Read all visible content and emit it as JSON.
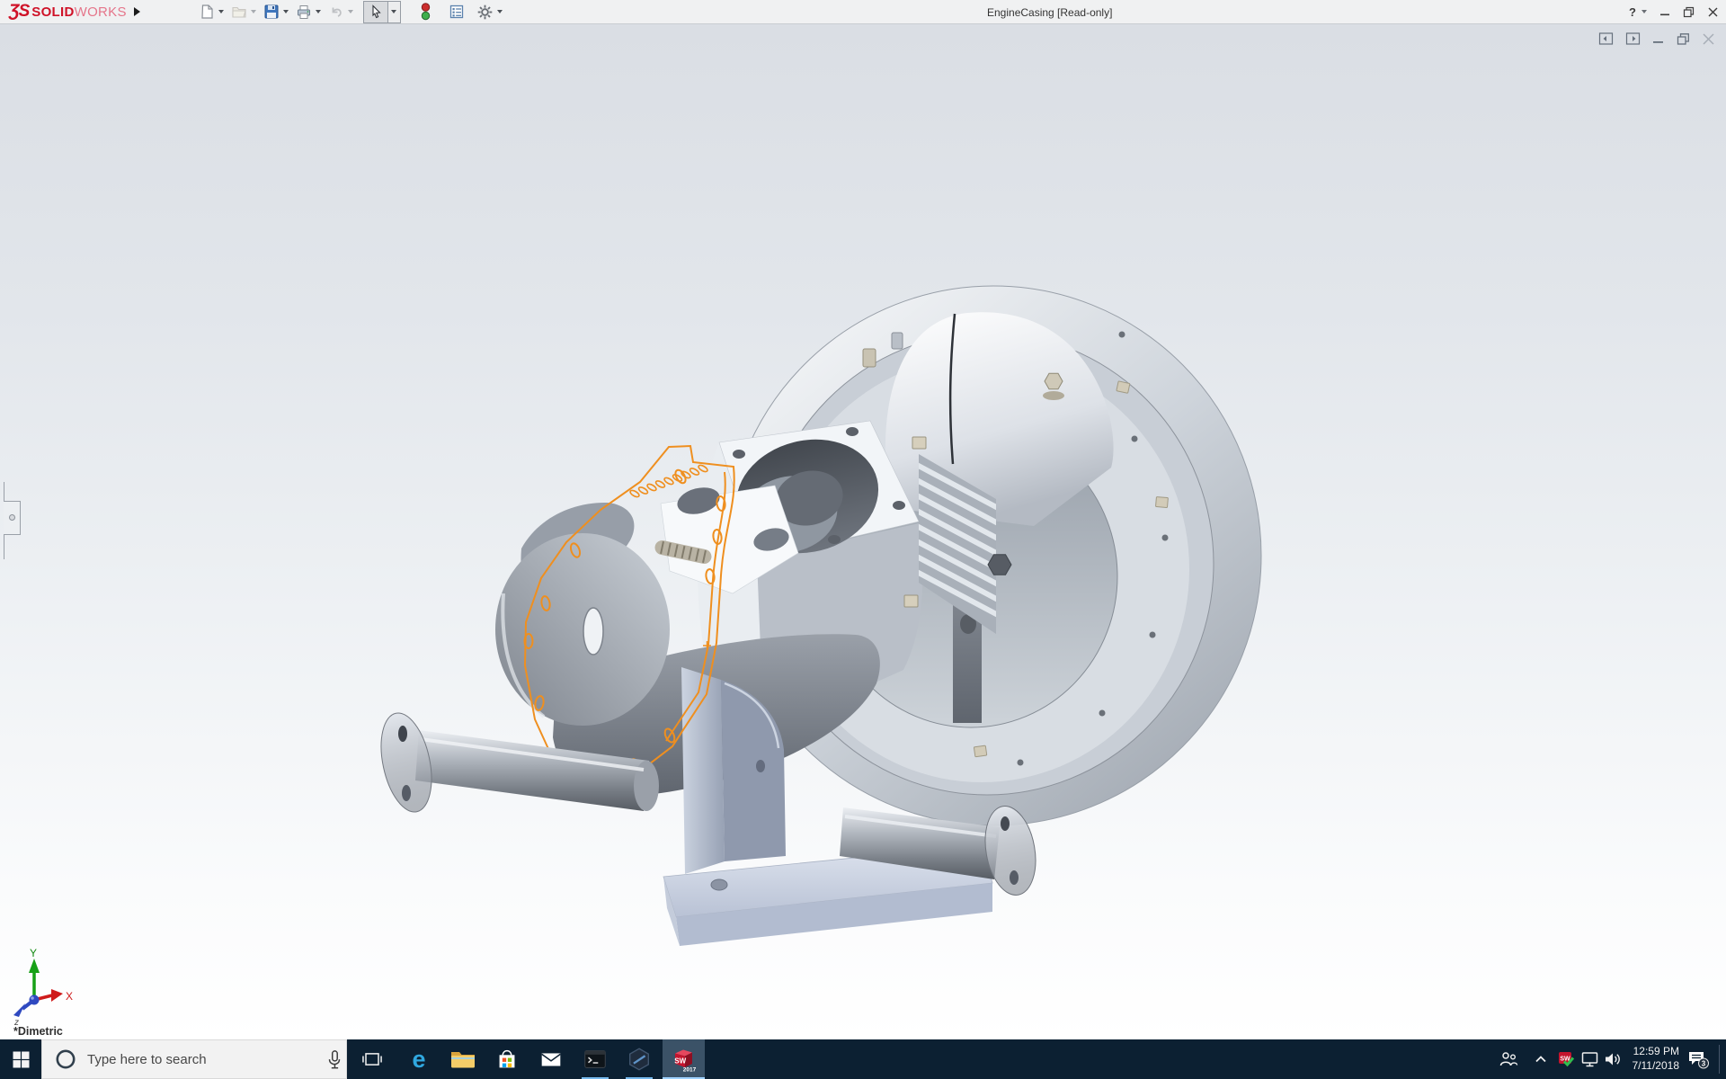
{
  "window": {
    "brand": {
      "logo_mark": "ƷS",
      "name_bold": "SOLID",
      "name_light": "WORKS"
    },
    "title": "EngineCasing [Read-only]",
    "help_label": "?"
  },
  "toolbar": {
    "icons": [
      "new-document",
      "open",
      "save",
      "print",
      "undo",
      "select-cursor",
      "rebuild-traffic-light",
      "display-options",
      "settings-gear"
    ]
  },
  "document_controls": {
    "icons": [
      "pane-left",
      "pane-right",
      "minimize-document",
      "restore-document",
      "close-document"
    ]
  },
  "viewport": {
    "view_label": "*Dimetric",
    "triad": {
      "x_label": "X",
      "y_label": "Y",
      "z_label": "z"
    }
  },
  "taskbar": {
    "search_placeholder": "Type here to search",
    "edge_glyph": "e",
    "sw_app": {
      "text": "SW",
      "year": "2017"
    },
    "tray_sw_text": "SW",
    "clock": {
      "time": "12:59 PM",
      "date": "7/11/2018"
    },
    "action_center_badge": "3",
    "icons": [
      "start",
      "search",
      "microphone",
      "task-view",
      "edge",
      "file-explorer",
      "store",
      "mail",
      "command-prompt",
      "hexagon-app",
      "solidworks-2017",
      "people",
      "tray-expand",
      "solidworks-resource-monitor",
      "network",
      "volume",
      "action-center",
      "show-desktop"
    ]
  },
  "colors": {
    "selection_orange": "#ef8f1f",
    "solidworks_red": "#cf1228",
    "taskbar_bg": "#0c2032",
    "running_indicator": "#76b9ed"
  }
}
